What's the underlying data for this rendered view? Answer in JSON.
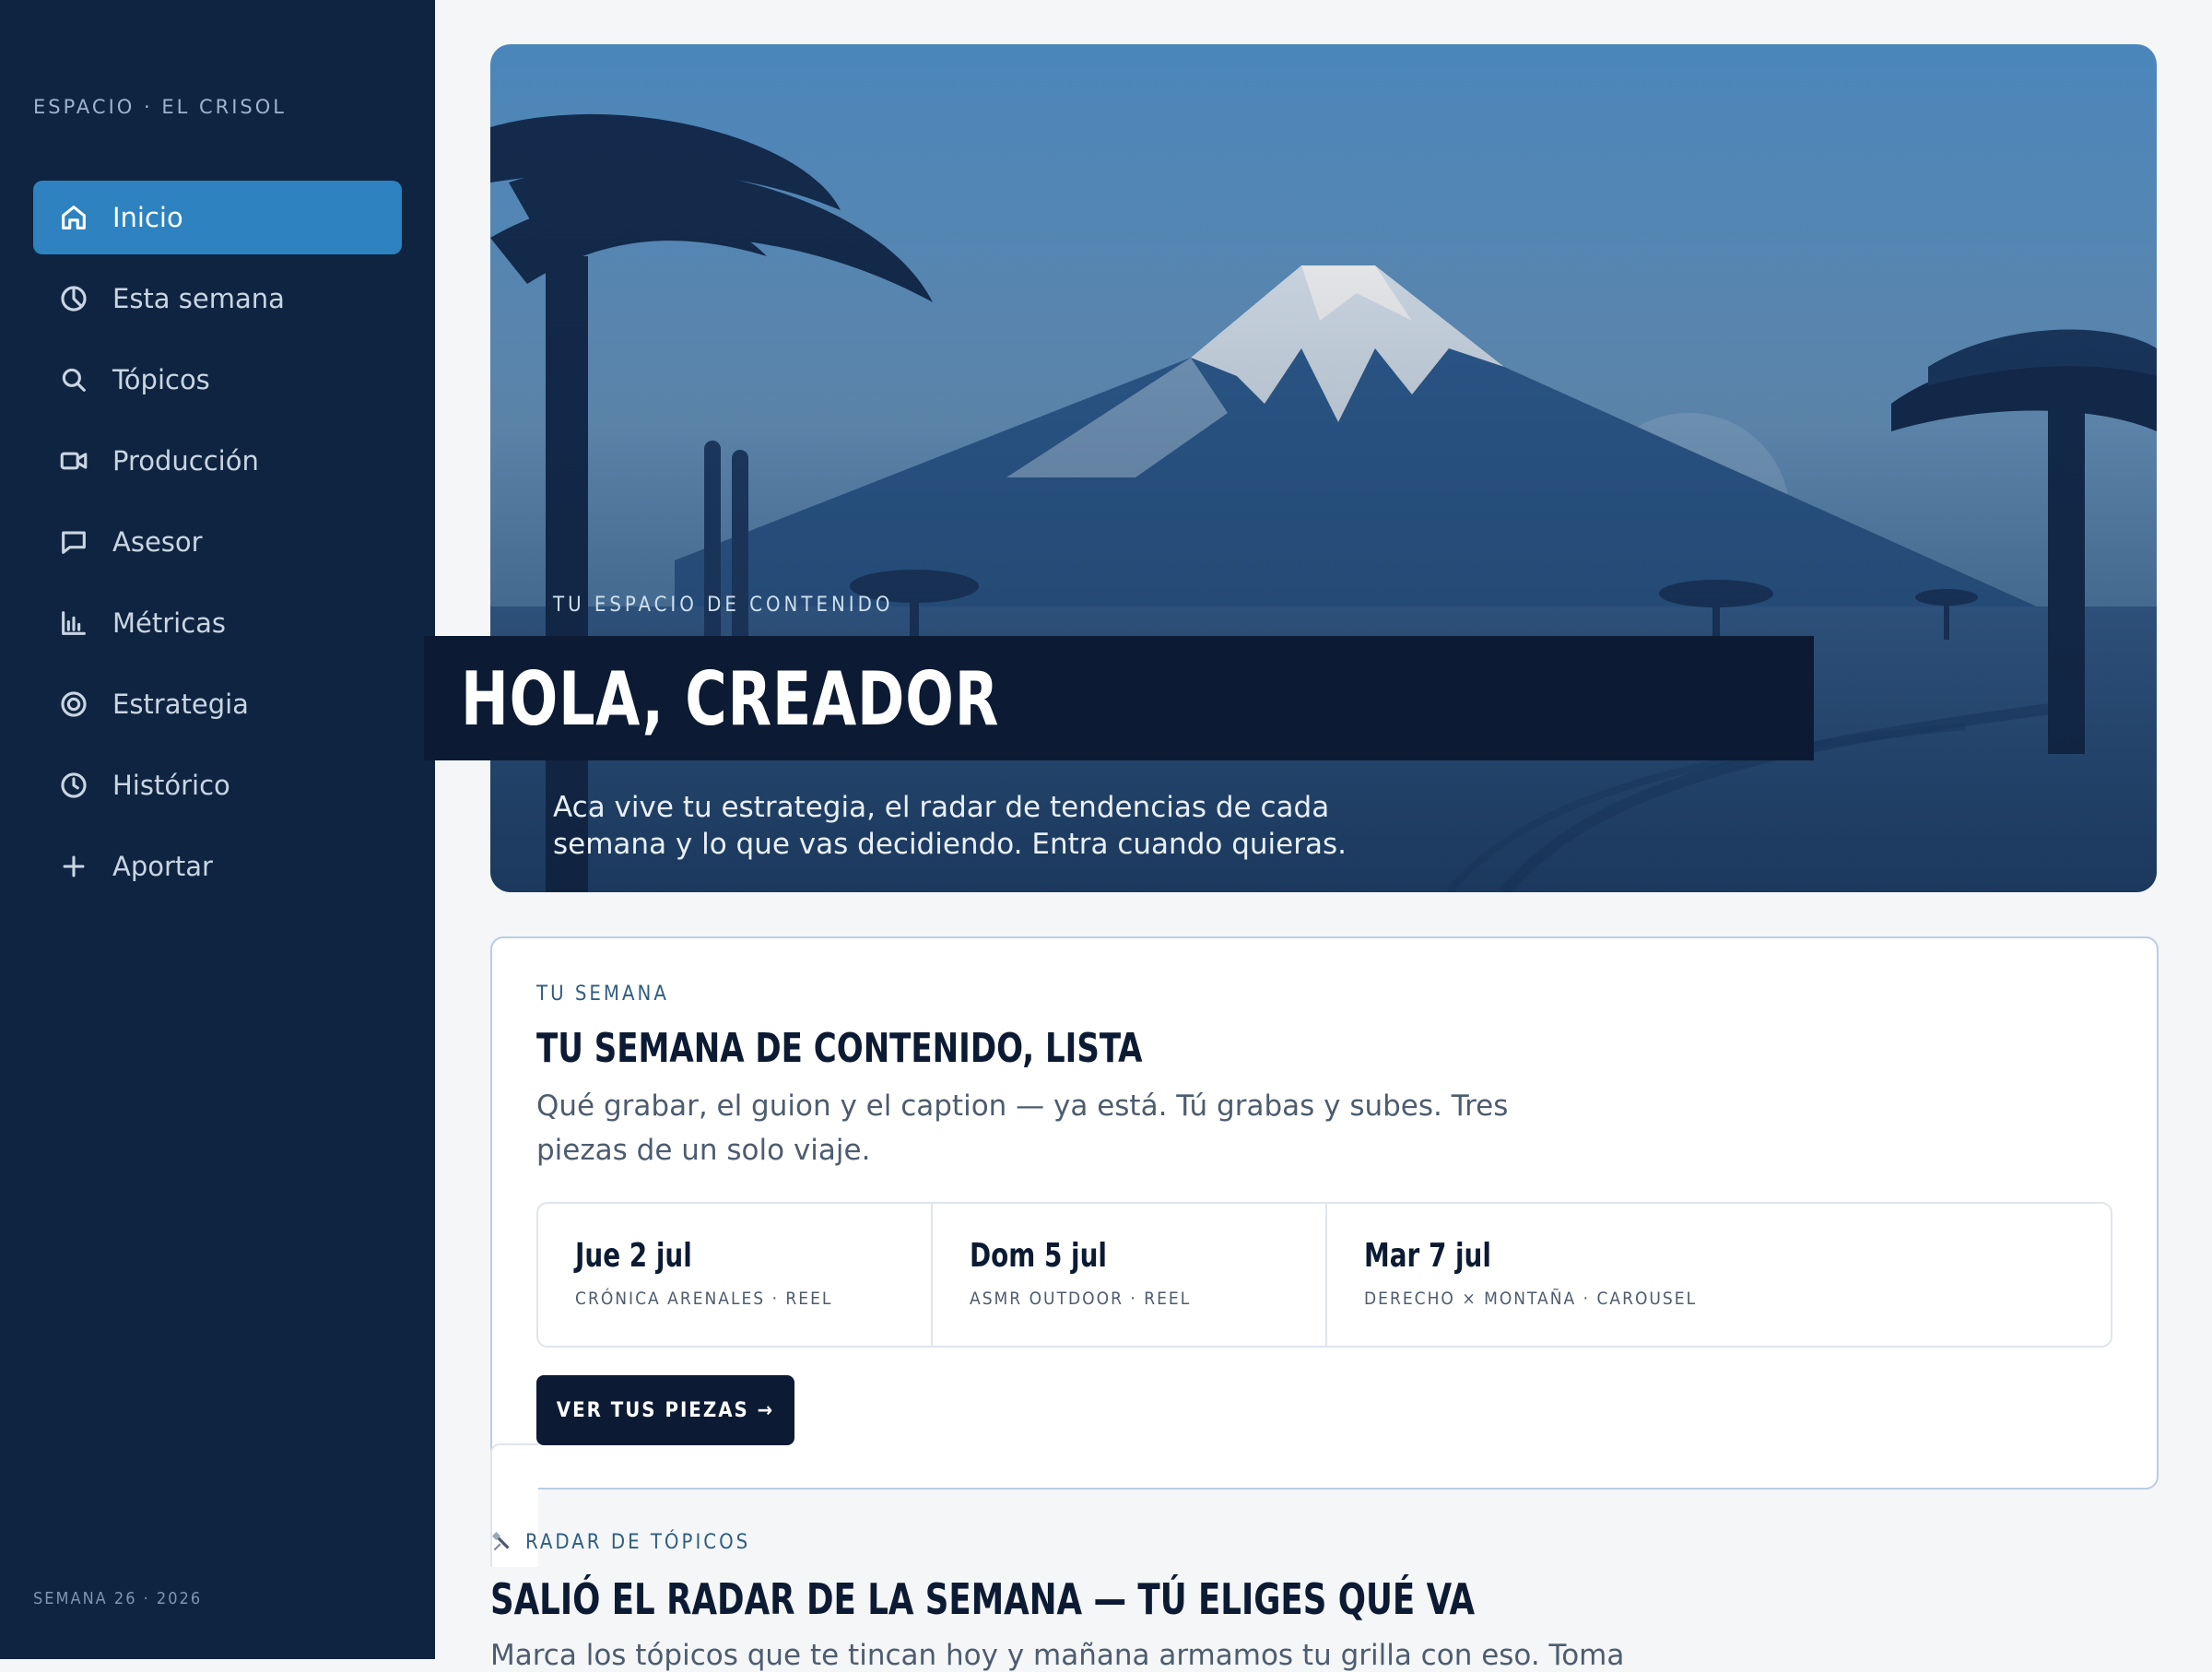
{
  "sidebar": {
    "brand": "ESPACIO · EL CRISOL",
    "items": [
      {
        "label": "Inicio",
        "icon": "home-icon",
        "active": true
      },
      {
        "label": "Esta semana",
        "icon": "pie-clock-icon"
      },
      {
        "label": "Tópicos",
        "icon": "search-icon"
      },
      {
        "label": "Producción",
        "icon": "video-icon"
      },
      {
        "label": "Asesor",
        "icon": "chat-icon"
      },
      {
        "label": "Métricas",
        "icon": "bar-chart-icon"
      },
      {
        "label": "Estrategia",
        "icon": "target-icon"
      },
      {
        "label": "Histórico",
        "icon": "clock-icon"
      },
      {
        "label": "Aportar",
        "icon": "plus-icon"
      }
    ],
    "week": "SEMANA 26 · 2026"
  },
  "hero": {
    "eyebrow": "TU ESPACIO DE CONTENIDO",
    "title": "HOLA, CREADOR",
    "subtitle": "Aca vive tu estrategia, el radar de tendencias de cada semana y lo que vas decidiendo. Entra cuando quieras."
  },
  "week_card": {
    "eyebrow": "TU SEMANA",
    "title": "TU SEMANA DE CONTENIDO, LISTA",
    "description": "Qué grabar, el guion y el caption — ya está. Tú grabas y subes. Tres piezas de un solo viaje.",
    "days": [
      {
        "date": "Jue 2 jul",
        "meta": "CRÓNICA ARENALES · REEL"
      },
      {
        "date": "Dom 5 jul",
        "meta": "ASMR OUTDOOR · REEL"
      },
      {
        "date": "Mar 7 jul",
        "meta": "DERECHO × MONTAÑA · CAROUSEL"
      }
    ],
    "cta": "VER TUS PIEZAS →"
  },
  "radar": {
    "eyebrow": "RADAR DE TÓPICOS",
    "icon": "satellite-icon",
    "title": "SALIÓ EL RADAR DE LA SEMANA — TÚ ELIGES QUÉ VA",
    "description": "Marca los tópicos que te tincan hoy y mañana armamos tu grilla con eso. Toma"
  },
  "colors": {
    "sidebar_bg": "#0e2440",
    "accent": "#2d82bf",
    "ink": "#0c1b33",
    "page_bg": "#f4f6f8"
  }
}
